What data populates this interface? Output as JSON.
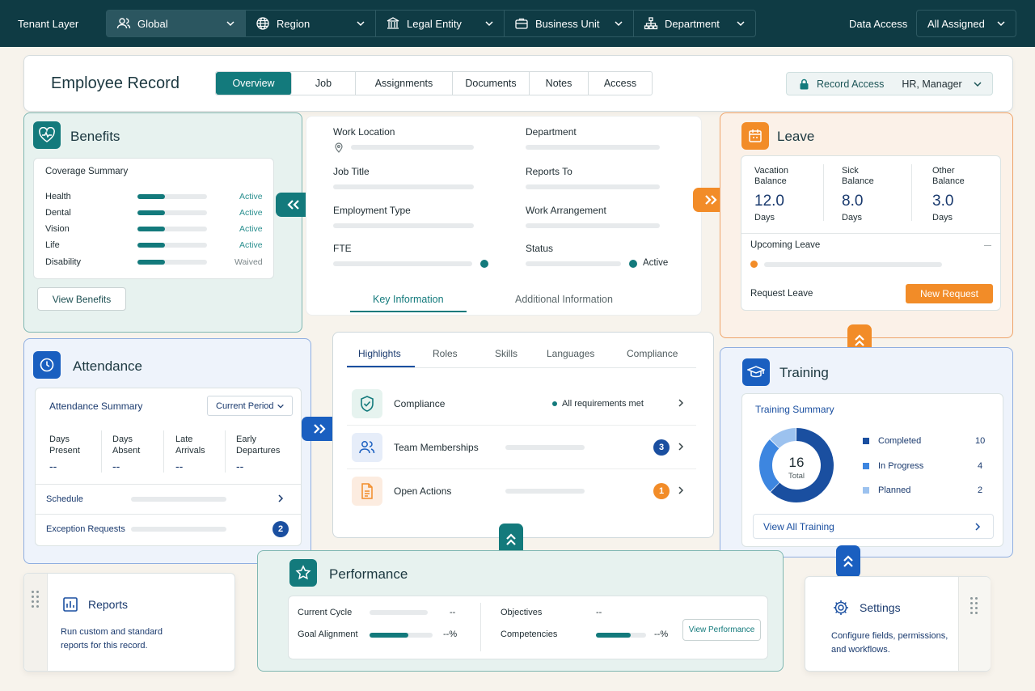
{
  "topbar": {
    "tenant_label": "Tenant Layer",
    "filters": [
      {
        "label": "Global",
        "icon": "users-icon"
      },
      {
        "label": "Region",
        "icon": "globe-icon"
      },
      {
        "label": "Legal Entity",
        "icon": "building-icon"
      },
      {
        "label": "Business Unit",
        "icon": "briefcase-icon"
      },
      {
        "label": "Department",
        "icon": "org-chart-icon"
      }
    ],
    "data_access_label": "Data Access",
    "data_access_value": "All Assigned"
  },
  "header": {
    "title": "Employee Record",
    "tabs": [
      "Overview",
      "Job",
      "Assignments",
      "Documents",
      "Notes",
      "Access"
    ],
    "active_tab": "Overview",
    "record_access_label": "Record Access",
    "record_access_value": "HR, Manager"
  },
  "benefits": {
    "title": "Benefits",
    "summary_title": "Coverage Summary",
    "rows": [
      {
        "name": "Health",
        "status": "Active",
        "level": 0.4
      },
      {
        "name": "Dental",
        "status": "Active",
        "level": 0.4
      },
      {
        "name": "Vision",
        "status": "Active",
        "level": 0.4
      },
      {
        "name": "Life",
        "status": "Active",
        "level": 0.4
      },
      {
        "name": "Disability",
        "status": "Waived",
        "level": 0.4
      }
    ],
    "button": "View Benefits"
  },
  "fields": {
    "work_location": "Work Location",
    "department": "Department",
    "job_title": "Job Title",
    "reports_to": "Reports To",
    "employment_type": "Employment Type",
    "work_arrangement": "Work Arrangement",
    "fte": "FTE",
    "status": "Status",
    "status_value": "Active"
  },
  "info_tabs": {
    "key": "Key Information",
    "additional": "Additional Information"
  },
  "highlights": {
    "tabs": [
      "Highlights",
      "Roles",
      "Skills",
      "Languages",
      "Compliance"
    ],
    "rows": [
      {
        "label": "Compliance",
        "status": "All requirements met"
      },
      {
        "label": "Team Memberships",
        "count": "3"
      },
      {
        "label": "Open Actions",
        "count": "1"
      }
    ]
  },
  "leave": {
    "title": "Leave",
    "balances": [
      {
        "label1": "Vacation",
        "label2": "Balance",
        "value": "12.0",
        "unit": "Days"
      },
      {
        "label1": "Sick",
        "label2": "Balance",
        "value": "8.0",
        "unit": "Days"
      },
      {
        "label1": "Other",
        "label2": "Balance",
        "value": "3.0",
        "unit": "Days"
      }
    ],
    "upcoming": "Upcoming Leave",
    "request_label": "Request Leave",
    "request_button": "New Request"
  },
  "attendance": {
    "title": "Attendance",
    "summary_title": "Attendance Summary",
    "period": "Current Period",
    "stats": [
      {
        "label1": "Days",
        "label2": "Present",
        "value": "--"
      },
      {
        "label1": "Days",
        "label2": "Absent",
        "value": "--"
      },
      {
        "label1": "Late",
        "label2": "Arrivals",
        "value": "--"
      },
      {
        "label1": "Early",
        "label2": "Departures",
        "value": "--"
      }
    ],
    "schedule": "Schedule",
    "exceptions": "Exception Requests",
    "exceptions_count": "2"
  },
  "training": {
    "title": "Training",
    "summary_title": "Training Summary",
    "total": "16",
    "total_label": "Total",
    "items": [
      {
        "label": "Completed",
        "value": "10",
        "color": "#1a4fa0"
      },
      {
        "label": "In Progress",
        "value": "4",
        "color": "#3d86e0"
      },
      {
        "label": "Planned",
        "value": "2",
        "color": "#9cc2ef"
      }
    ],
    "link": "View All Training"
  },
  "performance": {
    "title": "Performance",
    "current_cycle": "Current Cycle",
    "current_cycle_value": "--",
    "goal_alignment": "Goal Alignment",
    "goal_alignment_value": "--%",
    "goal_level": 0.62,
    "objectives": "Objectives",
    "objectives_value": "--",
    "competencies": "Competencies",
    "competencies_value": "--%",
    "competencies_level": 0.7,
    "button": "View Performance"
  },
  "reports": {
    "title": "Reports",
    "desc1": "Run custom and standard",
    "desc2": "reports for this record."
  },
  "settings": {
    "title": "Settings",
    "desc1": "Configure fields, permissions,",
    "desc2": "and workflows."
  },
  "colors": {
    "teal": "#137a7c",
    "orange": "#f28c28",
    "blue": "#1a4fa0",
    "navy": "#0f3b44"
  }
}
